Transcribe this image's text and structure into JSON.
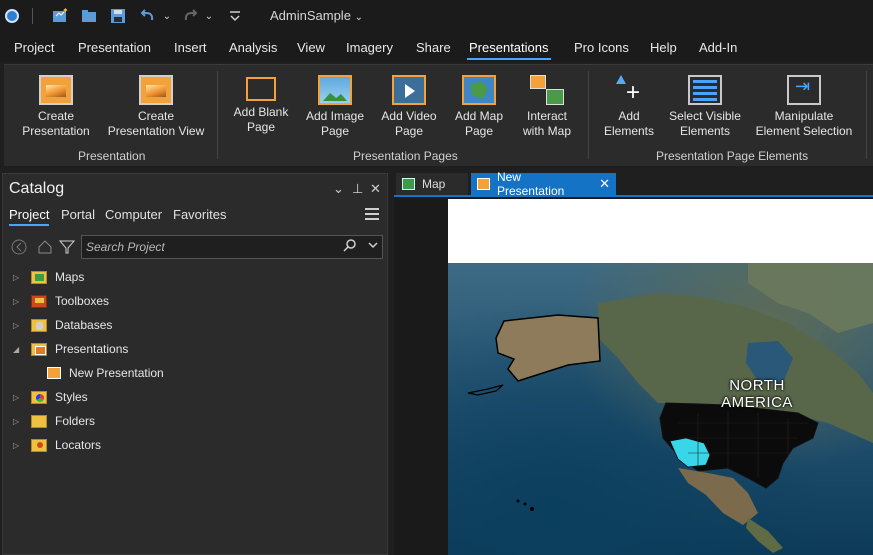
{
  "titlebar": {
    "app_title": "AdminSample",
    "title_chevron": "⌄",
    "icons": [
      "app-logo-icon",
      "new-project-icon",
      "open-project-icon",
      "save-project-icon",
      "undo-icon",
      "redo-icon",
      "customize-toolbar-icon"
    ]
  },
  "menu": {
    "items": [
      {
        "label": "Project"
      },
      {
        "label": "Presentation"
      },
      {
        "label": "Insert"
      },
      {
        "label": "Analysis"
      },
      {
        "label": "View"
      },
      {
        "label": "Imagery"
      },
      {
        "label": "Share"
      },
      {
        "label": "Presentations",
        "active": true
      },
      {
        "label": "Pro Icons"
      },
      {
        "label": "Help"
      },
      {
        "label": "Add-In"
      }
    ]
  },
  "ribbon": {
    "groups": [
      {
        "label": "Presentation"
      },
      {
        "label": "Presentation Pages"
      },
      {
        "label": "Presentation Page Elements"
      }
    ],
    "buttons": [
      {
        "line1": "Create",
        "line2": "Presentation",
        "icon": "presentation-icon"
      },
      {
        "line1": "Create",
        "line2": "Presentation View",
        "icon": "presentation-view-icon"
      },
      {
        "line1": "Add Blank",
        "line2": "Page",
        "icon": "blank-page-icon"
      },
      {
        "line1": "Add Image",
        "line2": "Page",
        "icon": "image-page-icon"
      },
      {
        "line1": "Add Video",
        "line2": "Page",
        "icon": "video-page-icon"
      },
      {
        "line1": "Add Map",
        "line2": "Page",
        "icon": "map-page-icon"
      },
      {
        "line1": "Interact",
        "line2": "with Map",
        "icon": "interact-map-icon"
      },
      {
        "line1": "Add",
        "line2": "Elements",
        "icon": "add-elements-icon"
      },
      {
        "line1": "Select Visible",
        "line2": "Elements",
        "icon": "select-visible-icon"
      },
      {
        "line1": "Manipulate",
        "line2": "Element Selection",
        "icon": "manipulate-selection-icon"
      }
    ]
  },
  "catalog": {
    "title": "Catalog",
    "controls": {
      "dropdown": "⌄",
      "pin": "⊥",
      "close": "✕"
    },
    "tabs": [
      {
        "label": "Project",
        "active": true
      },
      {
        "label": "Portal"
      },
      {
        "label": "Computer"
      },
      {
        "label": "Favorites"
      }
    ],
    "search": {
      "placeholder": "Search Project",
      "value": ""
    },
    "tree": [
      {
        "label": "Maps",
        "expanded": false,
        "icon": "maps-folder-icon"
      },
      {
        "label": "Toolboxes",
        "expanded": false,
        "icon": "toolbox-icon"
      },
      {
        "label": "Databases",
        "expanded": false,
        "icon": "database-icon"
      },
      {
        "label": "Presentations",
        "expanded": true,
        "icon": "presentations-folder-icon"
      },
      {
        "label": "New Presentation",
        "child": true,
        "icon": "presentation-item-icon"
      },
      {
        "label": "Styles",
        "expanded": false,
        "icon": "styles-icon"
      },
      {
        "label": "Folders",
        "expanded": false,
        "icon": "folder-icon"
      },
      {
        "label": "Locators",
        "expanded": false,
        "icon": "locator-icon"
      }
    ]
  },
  "doc_tabs": [
    {
      "label": "Map",
      "active": false,
      "icon": "map-tab-icon"
    },
    {
      "label": "New Presentation",
      "active": true,
      "icon": "presentation-tab-icon",
      "close": "✕"
    }
  ],
  "map_view": {
    "labels": {
      "line1": "NORTH",
      "line2": "AMERICA"
    },
    "highlight_color": "#38d6e8"
  },
  "colors": {
    "accent": "#1473c5",
    "active_underline": "#4aa3ff",
    "presentation_orange": "#f3a23a"
  }
}
